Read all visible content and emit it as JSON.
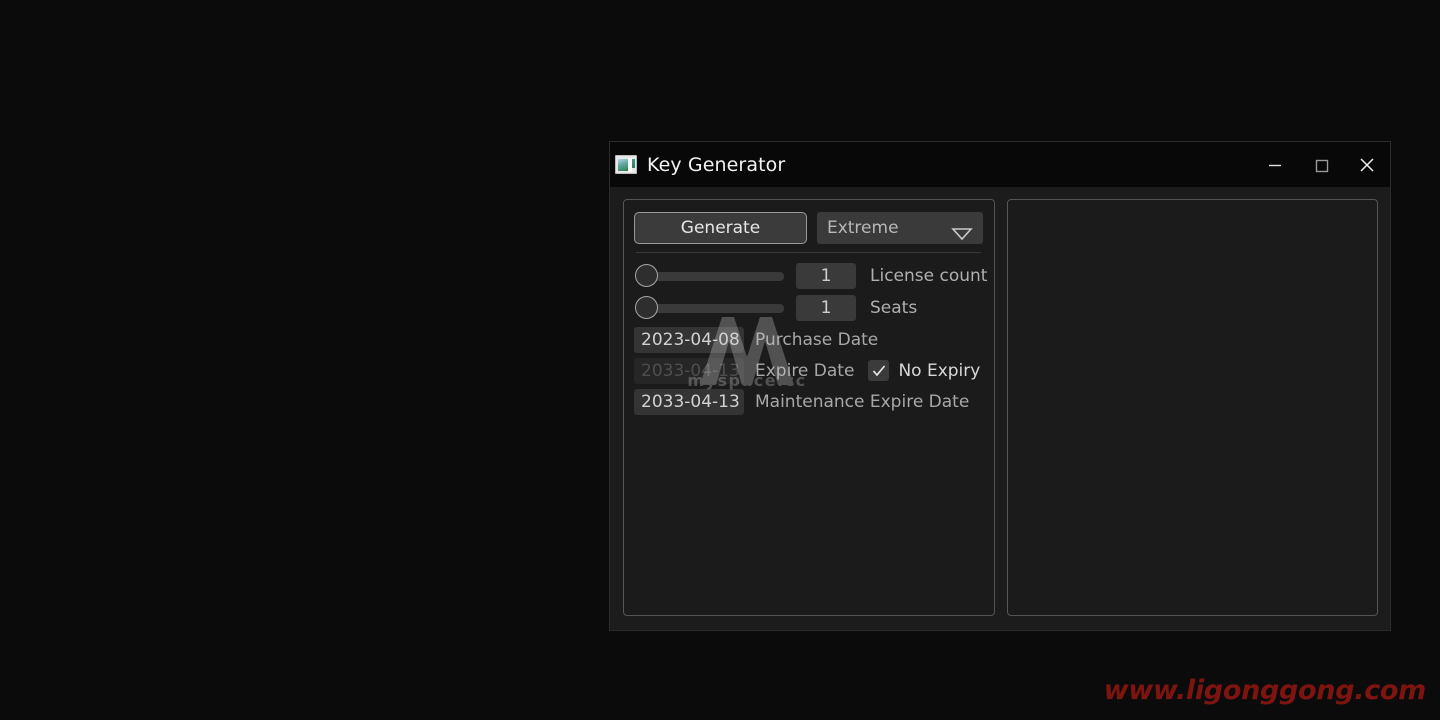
{
  "window": {
    "title": "Key Generator",
    "icon": "app-window-icon",
    "controls": {
      "minimize": "minimize-icon",
      "maximize": "maximize-icon",
      "close": "close-icon"
    }
  },
  "colors": {
    "desktop_bg": "#0b0b0b",
    "window_bg": "#1c1c1c",
    "titlebar_bg": "#080808",
    "panel_border": "#555555",
    "accent_text": "#e6e6e6",
    "watermark_red": "#7e1410"
  },
  "left_panel": {
    "generate_button": "Generate",
    "edition_select": {
      "value": "Extreme",
      "arrow_icon": "chevron-down-icon"
    },
    "sliders": [
      {
        "name": "license-count",
        "value": "1",
        "label": "License count",
        "position_percent": 0
      },
      {
        "name": "seats",
        "value": "1",
        "label": "Seats",
        "position_percent": 0
      }
    ],
    "dates": [
      {
        "name": "purchase-date",
        "value": "2023-04-08",
        "label": "Purchase Date",
        "disabled": false
      },
      {
        "name": "expire-date",
        "value": "2033-04-13",
        "label": "Expire Date",
        "disabled": true
      },
      {
        "name": "maintenance-expire-date",
        "value": "2033-04-13",
        "label": "Maintenance Expire Date",
        "disabled": false
      }
    ],
    "no_expiry": {
      "label": "No Expiry",
      "checked": true,
      "check_icon": "checkmark-icon"
    }
  },
  "right_panel": {
    "content": ""
  },
  "watermarks": {
    "center_logo_text": "myspace.cc",
    "bottom_right": "www.ligonggong.com"
  }
}
